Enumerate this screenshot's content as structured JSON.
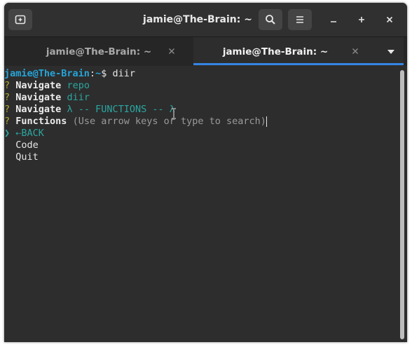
{
  "window": {
    "title": "jamie@The-Brain: ~",
    "controls": {
      "minimize": "–",
      "maximize": "+",
      "close": "×"
    }
  },
  "tabs": [
    {
      "label": "jamie@The-Brain: ~",
      "active": false
    },
    {
      "label": "jamie@The-Brain: ~",
      "active": true
    }
  ],
  "terminal": {
    "prompt_user": "jamie@The-Brain",
    "prompt_sep": ":",
    "prompt_path": "~",
    "prompt_symbol": "$ ",
    "command": "diir",
    "lines": [
      {
        "marker": "?",
        "key": "Navigate",
        "value": "repo"
      },
      {
        "marker": "?",
        "key": "Navigate",
        "value": "diir"
      },
      {
        "marker": "?",
        "key": "Navigate",
        "value": "λ -- FUNCTIONS -- λ"
      },
      {
        "marker": "?",
        "key": "Functions",
        "value": "(Use arrow keys or type to search)"
      }
    ],
    "menu_pointer": "❯",
    "menu_items": [
      "⇠BACK",
      "Code",
      "Quit"
    ]
  },
  "colors": {
    "accent": "#3584e4",
    "prompt_user": "#26a4d8",
    "question_marker": "#b5a92d",
    "cyan": "#2ba6a0"
  }
}
